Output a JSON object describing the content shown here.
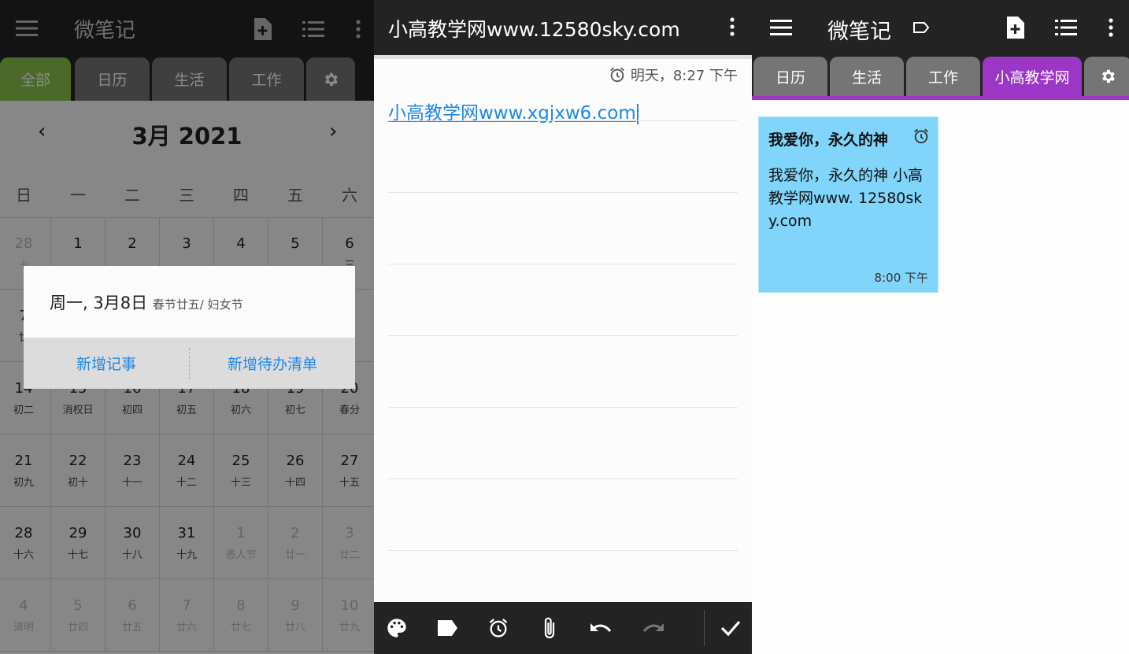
{
  "panel_calendar": {
    "app_title": "微笔记",
    "tabs": [
      "全部",
      "日历",
      "生活",
      "工作"
    ],
    "month_title": "3月 2021",
    "prev_label": "‹",
    "next_label": "›",
    "weekdays": [
      "日",
      "一",
      "二",
      "三",
      "四",
      "五",
      "六"
    ],
    "rows": [
      [
        {
          "d": "28",
          "s": "十",
          "dim": true
        },
        {
          "d": "1",
          "s": ""
        },
        {
          "d": "2",
          "s": ""
        },
        {
          "d": "3",
          "s": ""
        },
        {
          "d": "4",
          "s": ""
        },
        {
          "d": "5",
          "s": ""
        },
        {
          "d": "6",
          "s": "三"
        }
      ],
      [
        {
          "d": "7",
          "s": "廿"
        },
        {
          "d": "",
          "s": ""
        },
        {
          "d": "",
          "s": ""
        },
        {
          "d": "",
          "s": ""
        },
        {
          "d": "",
          "s": ""
        },
        {
          "d": "",
          "s": ""
        },
        {
          "d": "3",
          "s": "月"
        }
      ],
      [
        {
          "d": "14",
          "s": "初二"
        },
        {
          "d": "15",
          "s": "消权日"
        },
        {
          "d": "16",
          "s": "初四"
        },
        {
          "d": "17",
          "s": "初五"
        },
        {
          "d": "18",
          "s": "初六"
        },
        {
          "d": "19",
          "s": "初七"
        },
        {
          "d": "20",
          "s": "春分"
        }
      ],
      [
        {
          "d": "21",
          "s": "初九"
        },
        {
          "d": "22",
          "s": "初十"
        },
        {
          "d": "23",
          "s": "十一"
        },
        {
          "d": "24",
          "s": "十二"
        },
        {
          "d": "25",
          "s": "十三"
        },
        {
          "d": "26",
          "s": "十四"
        },
        {
          "d": "27",
          "s": "十五"
        }
      ],
      [
        {
          "d": "28",
          "s": "十六"
        },
        {
          "d": "29",
          "s": "十七"
        },
        {
          "d": "30",
          "s": "十八"
        },
        {
          "d": "31",
          "s": "十九"
        },
        {
          "d": "1",
          "s": "愚人节",
          "dim": true
        },
        {
          "d": "2",
          "s": "廿一",
          "dim": true
        },
        {
          "d": "3",
          "s": "廿二",
          "dim": true
        }
      ],
      [
        {
          "d": "4",
          "s": "清明",
          "dim": true
        },
        {
          "d": "5",
          "s": "廿四",
          "dim": true
        },
        {
          "d": "6",
          "s": "廿五",
          "dim": true
        },
        {
          "d": "7",
          "s": "廿六",
          "dim": true
        },
        {
          "d": "8",
          "s": "廿七",
          "dim": true
        },
        {
          "d": "9",
          "s": "廿八",
          "dim": true
        },
        {
          "d": "10",
          "s": "廿九",
          "dim": true
        }
      ]
    ],
    "dialog": {
      "title": "周一, 3月8日",
      "subtitle": "春节廿五/ 妇女节",
      "add_note": "新增记事",
      "add_todo": "新增待办清单"
    }
  },
  "panel_editor": {
    "title": "小高教学网www.12580sky.com",
    "reminder": "明天，8:27 下午",
    "body_link": "小高教学网www.xgjxw6.com"
  },
  "panel_list": {
    "app_title": "微笔记",
    "tabs": [
      "日历",
      "生活",
      "工作",
      "小高教学网"
    ],
    "note": {
      "title": "我爱你，永久的神",
      "body": "我爱你，永久的神 小高教学网www. 12580sky.com",
      "time": "8:00 下午",
      "color": "#81d4fa"
    }
  },
  "colors": {
    "toolbar": "#232323",
    "accent_green": "#8bc34a",
    "accent_purple": "#9c36c7",
    "link_blue": "#1e88e5"
  }
}
